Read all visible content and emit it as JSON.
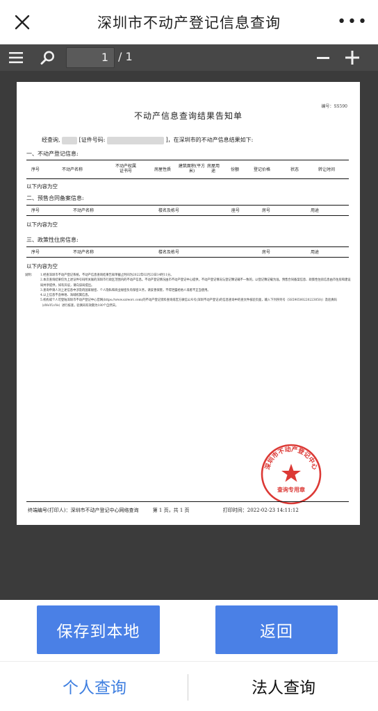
{
  "header": {
    "title": "深圳市不动产登记信息查询",
    "close_icon": "close-icon",
    "more_icon": "more-icon"
  },
  "toolbar": {
    "menu_icon": "menu-icon",
    "search_icon": "search-icon",
    "page_current": "1",
    "page_total": "/ 1",
    "zoom_out_icon": "zoom-out-icon",
    "zoom_in_icon": "zoom-in-icon"
  },
  "document": {
    "doc_no": "编号：SS590",
    "title": "不动产信息查询结果告知单",
    "intro_prefix": "经查询,",
    "intro_id_label": "[证件号码:",
    "intro_suffix": "]，在深圳市的不动产信息结果如下:",
    "section1": {
      "title": "一、不动产登记信息:",
      "columns": [
        "序号",
        "不动产名称",
        "不动产权属证书号",
        "房屋性质",
        "建筑面积(平方米)",
        "房屋用途",
        "份额",
        "登记价格",
        "状态",
        "转让时间"
      ],
      "empty": "以下内容为空"
    },
    "section2": {
      "title": "二、预售合同备案信息:",
      "columns": [
        "序号",
        "不动产名称",
        "楼名及栋号",
        "座号",
        "房号",
        "用途"
      ],
      "empty": "以下内容为空"
    },
    "section3": {
      "title": "三、政策性住房信息:",
      "columns": [
        "序号",
        "不动产名称",
        "楼名及栋号",
        "房号",
        "用途"
      ],
      "empty": "以下内容为空"
    },
    "notes_label": "说明：",
    "notes": [
      "1.经查深圳市不动产登记系统，不动产信息查询结果告知单截止时间为2022年02月23日14时11分。",
      "2.本次查询结果仅为上述证件号码所关联的深圳市行政区范围内的不动产信息。不动产登记情况由市不动产登记中心提供，不动产登记情况与登记簿记载不一致的，以登记簿记载为准。预售合同备案信息、政策性住房信息由市住房和建设局共享提供，如有异议，请向该局提出。",
      "3.查询申请人对上述信息中涉及的国家秘密、个人隐私和商业秘密负有保密义务，请妥善保管，不得泄露给他人或者不正当使用。",
      "4.以上信息不含林地、海域权属信息。",
      "5.机构或个人可登陆深圳市不动产登记中心官网(https://www.szreorc.com)的不动产登记资料查询或官方微信公众号(深圳不动产登记)的信息查询中的查文件核验页面，输入下列序列号（SS590500220223050)）及验真码（zWoYLvVe）进行核查，验真码有效期为180个自然日。"
    ],
    "stamp_text": "深圳市不动产登记中心",
    "stamp_subtext": "查询专用章",
    "footer_terminal": "终端编号(打印人)：深圳市不动产登记中心网络查询",
    "footer_page": "第 1 页，共 1 页",
    "footer_print_time": "打印时间：2022-02-23 14:11:12"
  },
  "actions": {
    "save_label": "保存到本地",
    "back_label": "返回"
  },
  "bottom_nav": {
    "personal_label": "个人查询",
    "corporate_label": "法人查询"
  },
  "colors": {
    "accent": "#4a80e6",
    "toolbar": "#474747",
    "viewer_bg": "#3b3b3b",
    "stamp_red": "#d8231f"
  }
}
